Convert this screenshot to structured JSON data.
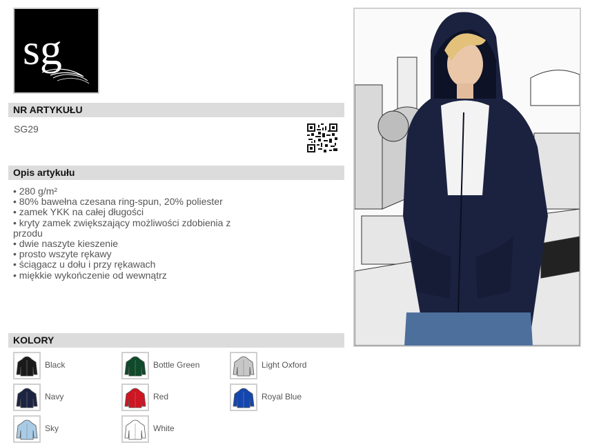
{
  "logo": {
    "text": "sg"
  },
  "article": {
    "header": "NR ARTYKUŁU",
    "number": "SG29"
  },
  "description": {
    "header": "Opis artykułu",
    "items": [
      "• 280 g/m²",
      "• 80% bawełna czesana ring-spun, 20% poliester",
      "• zamek YKK na całej długości",
      "• kryty zamek zwiększający możliwości zdobienia z przodu",
      "• dwie naszyte kieszenie",
      "• prosto wszyte rękawy",
      "• ściągacz u dołu i przy rękawach",
      "• miękkie wykończenie od wewnątrz"
    ]
  },
  "colors": {
    "header": "KOLORY",
    "items": [
      {
        "name": "Black",
        "hex": "#1a1a1a"
      },
      {
        "name": "Bottle Green",
        "hex": "#0f4a2a"
      },
      {
        "name": "Light Oxford",
        "hex": "#c7c7c7"
      },
      {
        "name": "Navy",
        "hex": "#1b2440"
      },
      {
        "name": "Red",
        "hex": "#d01522"
      },
      {
        "name": "Royal Blue",
        "hex": "#1446b0"
      },
      {
        "name": "Sky",
        "hex": "#a9cbe6"
      },
      {
        "name": "White",
        "hex": "#ffffff"
      }
    ]
  },
  "product_photo": {
    "garment_color": "#1b2240",
    "jeans_color": "#4d6f9c"
  }
}
